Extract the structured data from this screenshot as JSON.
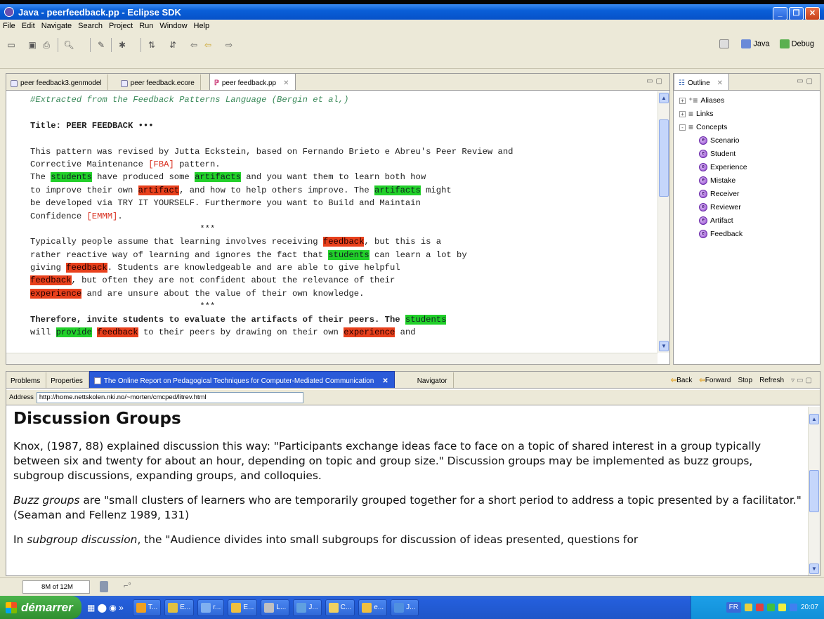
{
  "window": {
    "title": "Java - peerfeedback.pp - Eclipse SDK"
  },
  "menu": [
    "File",
    "Edit",
    "Navigate",
    "Search",
    "Project",
    "Run",
    "Window",
    "Help"
  ],
  "perspectives": [
    "Java",
    "Debug"
  ],
  "editor": {
    "tabs": [
      "peer feedback3.genmodel",
      "peer feedback.ecore",
      "peer feedback.pp"
    ],
    "lines": [
      [
        {
          "t": "#Extracted from the Feedback Patterns Language (Bergin et al,)",
          "s": "cm"
        }
      ],
      [],
      [
        {
          "t": "Title: PEER FEEDBACK •••",
          "s": "b"
        }
      ],
      [],
      [
        {
          "t": "This pattern was revised by Jutta Eckstein, based on Fernando Brieto e Abreu's Peer Review and"
        }
      ],
      [
        {
          "t": "Corrective Maintenance "
        },
        {
          "t": "[FBA]",
          "s": "ref"
        },
        {
          "t": " pattern."
        }
      ],
      [
        {
          "t": "The "
        },
        {
          "t": "students",
          "s": "g"
        },
        {
          "t": " have produced some "
        },
        {
          "t": "artifacts",
          "s": "g"
        },
        {
          "t": " and you want them to learn both how"
        }
      ],
      [
        {
          "t": "to improve their own "
        },
        {
          "t": "artifact",
          "s": "r"
        },
        {
          "t": ", and how to help others improve. The "
        },
        {
          "t": "artifacts",
          "s": "g"
        },
        {
          "t": " might"
        }
      ],
      [
        {
          "t": "be developed via TRY IT YOURSELF. Furthermore you want to Build and Maintain"
        }
      ],
      [
        {
          "t": "Confidence "
        },
        {
          "t": "[EMMM]",
          "s": "ref"
        },
        {
          "t": "."
        }
      ],
      [
        {
          "t": "                                 ***"
        }
      ],
      [
        {
          "t": "Typically people assume that learning involves receiving "
        },
        {
          "t": "feedback",
          "s": "r"
        },
        {
          "t": ", but this is a"
        }
      ],
      [
        {
          "t": "rather reactive way of learning and ignores the fact that "
        },
        {
          "t": "students",
          "s": "g"
        },
        {
          "t": " can learn a lot by"
        }
      ],
      [
        {
          "t": "giving "
        },
        {
          "t": "feedback",
          "s": "r"
        },
        {
          "t": ". Students are knowledgeable and are able to give helpful"
        }
      ],
      [
        {
          "t": "feedback",
          "s": "r"
        },
        {
          "t": ", but often they are not confident about the relevance of their"
        }
      ],
      [
        {
          "t": "experience",
          "s": "r"
        },
        {
          "t": " and are unsure about the value of their own knowledge."
        }
      ],
      [
        {
          "t": "                                 ***"
        }
      ],
      [
        {
          "t": "Therefore, invite students to evaluate the artifacts of their peers. The ",
          "s": "b"
        },
        {
          "t": "students",
          "s": "g"
        }
      ],
      [
        {
          "t": "will "
        },
        {
          "t": "provide",
          "s": "g"
        },
        {
          "t": " "
        },
        {
          "t": "feedback",
          "s": "r"
        },
        {
          "t": " to their peers by drawing on their own "
        },
        {
          "t": "experience",
          "s": "r"
        },
        {
          "t": " and"
        }
      ]
    ]
  },
  "outline": {
    "tab": "Outline",
    "groups": [
      {
        "label": "Aliases",
        "expander": "+"
      },
      {
        "label": "Links",
        "expander": "+"
      },
      {
        "label": "Concepts",
        "expander": "-"
      }
    ],
    "concepts": [
      "Scenario",
      "Student",
      "Experience",
      "Mistake",
      "Receiver",
      "Reviewer",
      "Artifact",
      "Feedback"
    ]
  },
  "bottom_tabs": [
    "Problems",
    "Properties",
    "The Online Report on Pedagogical Techniques for Computer-Mediated Communication",
    "Navigator"
  ],
  "browser": {
    "back": "Back",
    "forward": "Forward",
    "stop": "Stop",
    "refresh": "Refresh",
    "address_label": "Address",
    "address": "http://home.nettskolen.nki.no/~morten/cmcped/litrev.html",
    "heading": "Discussion Groups",
    "p1": "Knox, (1987, 88) explained discussion this way: \"Participants exchange ideas face to face on a topic of shared interest in a group typically between six and twenty for about an hour, depending on topic and group size.\" Discussion groups may be implemented as buzz groups, subgroup discussions, expanding groups, and colloquies.",
    "p2_em": "Buzz groups",
    "p2": " are \"small clusters of learners who are temporarily grouped together for a short period to address a topic presented by a facilitator.\" (Seaman and Fellenz 1989, 131)",
    "p3_pre": "In ",
    "p3_em": "subgroup discussion",
    "p3": ", the \"Audience divides into small subgroups for discussion of ideas presented, questions for"
  },
  "status": {
    "heap": "8M of 12M"
  },
  "taskbar": {
    "start": "démarrer",
    "items": [
      "T...",
      "E...",
      "r...",
      "E...",
      "L...",
      "J...",
      "C...",
      "e...",
      "J..."
    ],
    "lang": "FR",
    "clock": "20:07"
  }
}
